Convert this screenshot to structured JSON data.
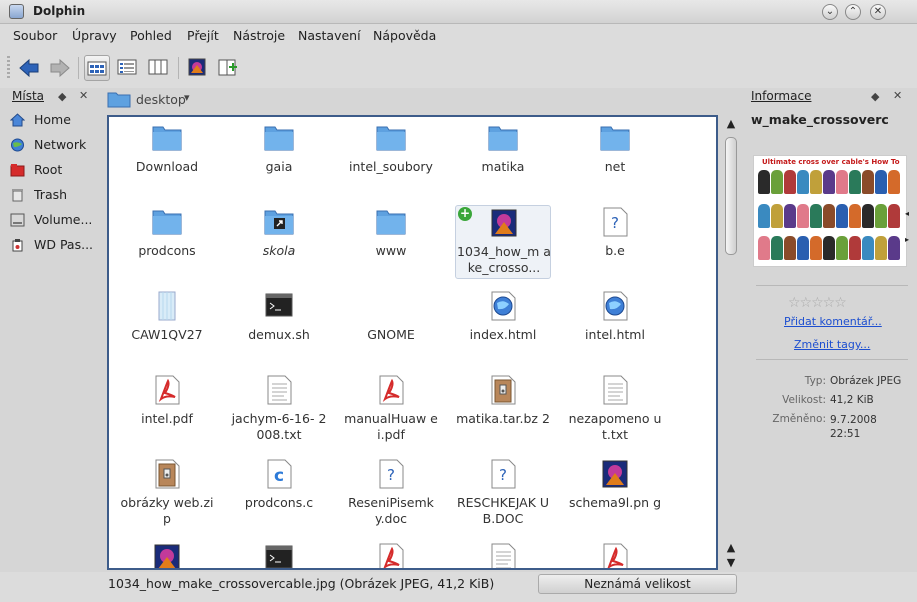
{
  "window": {
    "title": "Dolphin"
  },
  "menu": [
    "Soubor",
    "Úpravy",
    "Pohled",
    "Přejít",
    "Nástroje",
    "Nastavení",
    "Nápověda"
  ],
  "places": {
    "title": "Místa",
    "items": [
      {
        "label": "Home",
        "icon": "home-icon"
      },
      {
        "label": "Network",
        "icon": "network-globe-icon"
      },
      {
        "label": "Root",
        "icon": "root-folder-icon"
      },
      {
        "label": "Trash",
        "icon": "trash-icon"
      },
      {
        "label": "Volume...",
        "icon": "hard-drive-icon"
      },
      {
        "label": "WD Pas...",
        "icon": "usb-drive-icon"
      }
    ]
  },
  "breadcrumb": {
    "label": "desktop"
  },
  "files": [
    {
      "label": "Download",
      "icon": "folder-icon"
    },
    {
      "label": "gaia",
      "icon": "folder-icon"
    },
    {
      "label": "intel_soubory",
      "icon": "folder-icon"
    },
    {
      "label": "matika",
      "icon": "folder-icon"
    },
    {
      "label": "net",
      "icon": "folder-icon"
    },
    {
      "label": "prodcons",
      "icon": "folder-icon"
    },
    {
      "label": "skola",
      "icon": "folder-link-icon"
    },
    {
      "label": "www",
      "icon": "folder-icon"
    },
    {
      "label": "1034_how_m ake_crosso...",
      "icon": "image-file-icon"
    },
    {
      "label": "b.e",
      "icon": "unknown-file-icon"
    },
    {
      "label": "CAW1QV27",
      "icon": "blank-file-icon"
    },
    {
      "label": "demux.sh",
      "icon": "terminal-script-icon"
    },
    {
      "label": "GNOME",
      "icon": ""
    },
    {
      "label": "index.html",
      "icon": "html-file-icon"
    },
    {
      "label": "intel.html",
      "icon": "html-file-icon"
    },
    {
      "label": "intel.pdf",
      "icon": "pdf-file-icon"
    },
    {
      "label": "jachym-6-16- 2008.txt",
      "icon": "text-file-icon"
    },
    {
      "label": "manualHuaw ei.pdf",
      "icon": "pdf-file-icon"
    },
    {
      "label": "matika.tar.bz 2",
      "icon": "archive-file-icon"
    },
    {
      "label": "nezapomeno ut.txt",
      "icon": "text-file-icon"
    },
    {
      "label": "obrázky web.zip",
      "icon": "archive-file-icon"
    },
    {
      "label": "prodcons.c",
      "icon": "c-source-file-icon"
    },
    {
      "label": "ReseniPisemk y.doc",
      "icon": "unknown-file-icon"
    },
    {
      "label": "RESCHKEJAK UB.DOC",
      "icon": "unknown-file-icon"
    },
    {
      "label": "schema9l.pn g",
      "icon": "image-file-icon"
    },
    {
      "label": "",
      "icon": "image-file-icon"
    },
    {
      "label": "",
      "icon": "terminal-script-icon"
    },
    {
      "label": "",
      "icon": "pdf-file-icon"
    },
    {
      "label": "",
      "icon": "text-file-icon"
    },
    {
      "label": "",
      "icon": "pdf-file-icon"
    }
  ],
  "status": {
    "text": "1034_how_make_crossovercable.jpg (Obrázek JPEG, 41,2 KiB)",
    "size_label": "Neznámá velikost"
  },
  "info": {
    "title": "Informace",
    "filename": "w_make_crossoverc",
    "preview_title": "Ultimate cross over cable's How To",
    "add_comment": "Přidat komentář...",
    "change_tags": "Změnit tagy...",
    "meta": [
      {
        "label": "Typ:",
        "value": "Obrázek JPEG"
      },
      {
        "label": "Velikost:",
        "value": "41,2 KiB"
      },
      {
        "label": "Změněno:",
        "value": "9.7.2008 22:51"
      }
    ]
  },
  "colors": {
    "selection_border": "#3d5c8a",
    "folder": "#5ea1e0",
    "link": "#1d4fd0"
  }
}
